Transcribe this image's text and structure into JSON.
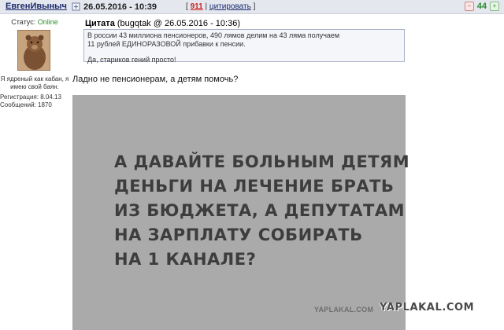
{
  "post": {
    "author": "ЕвгенИвыныч",
    "date": "26.05.2016 - 10:39",
    "number": "911",
    "cite_label": "цитировать",
    "rating": "44"
  },
  "user": {
    "status_label": "Статус:",
    "status_value": "Online",
    "tagline_1": "Я ядреный как кабан, я",
    "tagline_2": "имею свой баян.",
    "registered": "Регистрация: 8.04.13",
    "messages": "Сообщений: 1870"
  },
  "quote": {
    "label": "Цитата",
    "source": "(bugqtak @ 26.05.2016 - 10:36)",
    "line1": "В россии 43 миллиона пенсионеров, 490 лямов делим на 43 ляма получаем",
    "line2": "11 рублей ЕДИНОРАЗОВОЙ прибавки к пенсии.",
    "line3": "Да, стариков гений просто!"
  },
  "reply_text": "Ладно не пенсионерам, а детям помочь?",
  "image": {
    "lines": [
      "А давайте больным детям",
      "деньги на лечение брать",
      "из бюджета, а депутатам",
      "на зарплату собирать",
      "на 1 канале?"
    ],
    "watermark_small": "YAPLAKAL.COM"
  },
  "watermark_big": "YAPLAKAL.COM",
  "colors": {
    "header_bg": "#e4e7ee",
    "link": "#1a2a6c",
    "post_number": "#cc1f1f",
    "rating": "#2e8b2e",
    "image_bg": "#aaaaaa",
    "image_text": "#3d3d3d"
  }
}
